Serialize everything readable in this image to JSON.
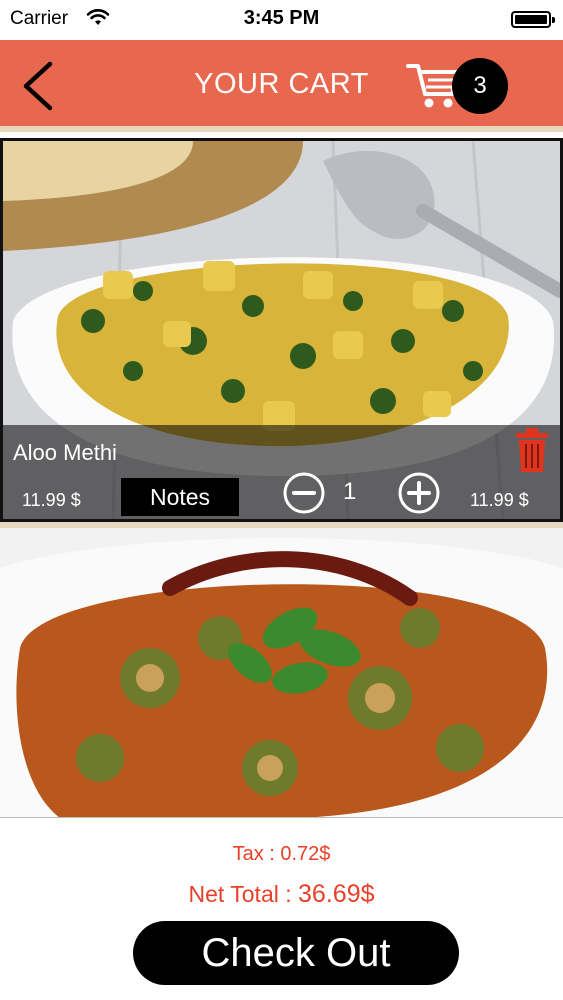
{
  "status_bar": {
    "carrier": "Carrier",
    "time": "3:45 PM"
  },
  "nav": {
    "title": "YOUR CART",
    "cart_count": "3"
  },
  "cart_items": [
    {
      "name": "Aloo Methi",
      "unit_price": "11.99 $",
      "notes_label": "Notes",
      "quantity": "1",
      "line_total": "11.99 $",
      "photo_icon": "aloo-methi-photo"
    },
    {
      "photo_icon": "bhindi-masala-photo"
    }
  ],
  "summary": {
    "tax_text": "Tax  : 0.72$",
    "net_total_prefix": "Net Total : ",
    "net_total_value": "36.69$"
  },
  "checkout_label": "Check Out",
  "colors": {
    "nav_background": "#e8674f",
    "accent_red": "#e8402a",
    "separator": "#e6d8bc",
    "trash": "#e0341f"
  }
}
